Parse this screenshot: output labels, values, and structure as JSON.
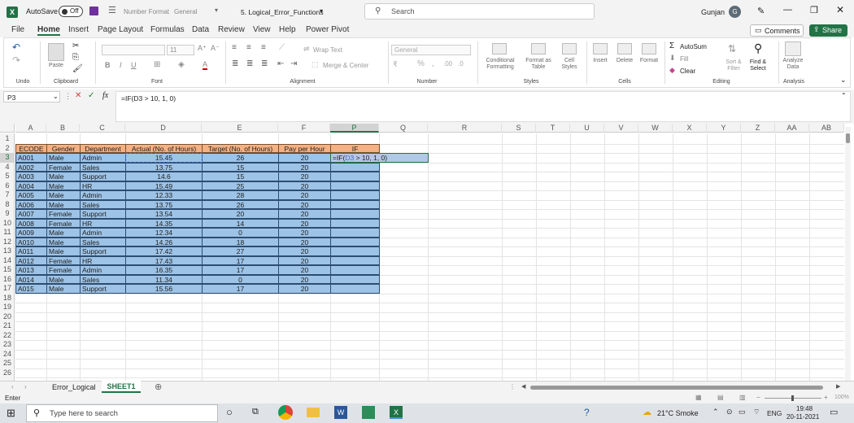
{
  "title": {
    "autosave": "AutoSave",
    "autosave_state": "Off",
    "number_format": "Number Format",
    "number_format_value": "General",
    "filename": "5. Logical_Error_Functions",
    "search": "Search",
    "user": "Gunjan",
    "avatar": "G"
  },
  "menu": [
    "File",
    "Home",
    "Insert",
    "Page Layout",
    "Formulas",
    "Data",
    "Review",
    "View",
    "Help",
    "Power Pivot"
  ],
  "menu_active": "Home",
  "buttons": {
    "comments": "Comments",
    "share": "Share"
  },
  "ribbon": {
    "groups": [
      "Undo",
      "Clipboard",
      "Font",
      "Alignment",
      "Number",
      "Styles",
      "Cells",
      "Editing",
      "Analysis"
    ],
    "paste": "Paste",
    "font_size": "11",
    "wrap_text": "Wrap Text",
    "merge_center": "Merge & Center",
    "number_format": "General",
    "conditional_formatting": "Conditional Formatting",
    "format_as_table": "Format as Table",
    "cell_styles": "Cell Styles",
    "insert": "Insert",
    "delete": "Delete",
    "format": "Format",
    "autosum": "AutoSum",
    "fill": "Fill",
    "clear": "Clear",
    "sort_filter": "Sort & Filter",
    "find_select": "Find & Select",
    "analyze_data": "Analyze Data"
  },
  "formula_bar": {
    "name_box": "P3",
    "fx": "fx",
    "formula": "=IF(D3 > 10, 1, 0)"
  },
  "columns": [
    "A",
    "B",
    "C",
    "D",
    "E",
    "F",
    "P",
    "Q",
    "R",
    "S",
    "T",
    "U",
    "V",
    "W",
    "X",
    "Y",
    "Z",
    "AA",
    "AB"
  ],
  "row_numbers": [
    "1",
    "2",
    "3",
    "4",
    "5",
    "6",
    "7",
    "8",
    "9",
    "10",
    "11",
    "12",
    "13",
    "14",
    "15",
    "16",
    "17",
    "18",
    "19",
    "20",
    "21",
    "22",
    "23",
    "24",
    "25",
    "26"
  ],
  "table": {
    "headers": [
      "ECODE",
      "Gender",
      "Department",
      "Actual (No. of Hours)",
      "Target (No. of Hours)",
      "Pay per Hour",
      "IF"
    ],
    "rows": [
      [
        "A001",
        "Male",
        "Admin",
        "15.45",
        "26",
        "20"
      ],
      [
        "A002",
        "Female",
        "Sales",
        "13.75",
        "15",
        "20"
      ],
      [
        "A003",
        "Male",
        "Support",
        "14.6",
        "15",
        "20"
      ],
      [
        "A004",
        "Male",
        "HR",
        "15.49",
        "25",
        "20"
      ],
      [
        "A005",
        "Male",
        "Admin",
        "12.33",
        "28",
        "20"
      ],
      [
        "A006",
        "Male",
        "Sales",
        "13.75",
        "26",
        "20"
      ],
      [
        "A007",
        "Female",
        "Support",
        "13.54",
        "20",
        "20"
      ],
      [
        "A008",
        "Female",
        "HR",
        "14.35",
        "14",
        "20"
      ],
      [
        "A009",
        "Male",
        "Admin",
        "12.34",
        "0",
        "20"
      ],
      [
        "A010",
        "Male",
        "Sales",
        "14.26",
        "18",
        "20"
      ],
      [
        "A011",
        "Male",
        "Support",
        "17.42",
        "27",
        "20"
      ],
      [
        "A012",
        "Female",
        "HR",
        "17.43",
        "17",
        "20"
      ],
      [
        "A013",
        "Female",
        "Admin",
        "16.35",
        "17",
        "20"
      ],
      [
        "A014",
        "Male",
        "Sales",
        "11.34",
        "0",
        "20"
      ],
      [
        "A015",
        "Male",
        "Support",
        "15.56",
        "17",
        "20"
      ]
    ],
    "editing": {
      "prefix": "=IF(",
      "ref": "D3",
      "suffix": " > 10, 1, 0)"
    }
  },
  "sheet_tabs": [
    "Error_Logical",
    "SHEET1"
  ],
  "active_sheet": "SHEET1",
  "status": {
    "mode": "Enter",
    "zoom": "100%"
  },
  "taskbar": {
    "search": "Type here to search",
    "weather": "21°C Smoke",
    "lang": "ENG",
    "time": "19:48",
    "date": "20-11-2021"
  },
  "colors": {
    "excel_green": "#217346",
    "header_orange": "#f4b183",
    "body_blue": "#9dc3e6",
    "ref_blue": "#4472c4"
  }
}
